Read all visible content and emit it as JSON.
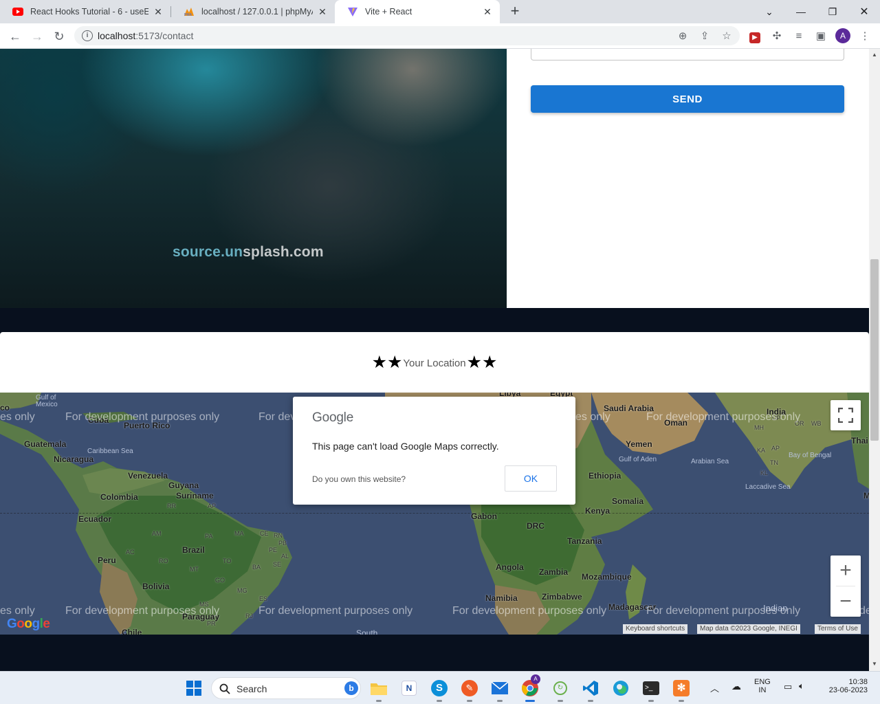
{
  "browser": {
    "tabs": [
      {
        "title": "React Hooks Tutorial - 6 - useEffe",
        "favicon": "youtube-icon",
        "active": false
      },
      {
        "title": "localhost / 127.0.0.1 | phpMyAdm",
        "favicon": "phpmyadmin-icon",
        "active": false
      },
      {
        "title": "Vite + React",
        "favicon": "vite-icon",
        "active": true
      }
    ],
    "address": {
      "host": "localhost",
      "path": ":5173/contact"
    },
    "profile_initial": "A"
  },
  "page": {
    "hero_watermark": {
      "part1": "source.un",
      "part2": "splash.com"
    },
    "send_label": "SEND",
    "location": {
      "star": "★",
      "title": "Your Location"
    }
  },
  "map": {
    "dev_text": "For development purposes only",
    "dev_text_cut": "es only",
    "dev_text_start": "For dev",
    "dev_text_tail": "de",
    "labels": {
      "puerto_rico": "Puerto Rico",
      "guatemala": "Guatemala",
      "nicaragua": "Nicaragua",
      "venezuela": "Venezuela",
      "guyana": "Guyana",
      "suriname": "Suriname",
      "colombia": "Colombia",
      "ecuador": "Ecuador",
      "peru": "Peru",
      "brazil": "Brazil",
      "bolivia": "Bolivia",
      "paraguay": "Paraguay",
      "chile": "Chile",
      "saudi_arabia": "Saudi Arabia",
      "oman": "Oman",
      "yemen": "Yemen",
      "ethiopia": "Ethiopia",
      "somalia": "Somalia",
      "kenya": "Kenya",
      "gabon": "Gabon",
      "drc": "DRC",
      "tanzania": "Tanzania",
      "angola": "Angola",
      "zambia": "Zambia",
      "mozambique": "Mozambique",
      "namibia": "Namibia",
      "zimbabwe": "Zimbabwe",
      "madagascar": "Madagascar",
      "india": "India",
      "yemen_gulf": "Gulf of Aden",
      "libya": "Libya",
      "egypt": "Egypt",
      "cuba": "Cuba",
      "mexico_gulf": "Gulf of\nMexico",
      "caribbean": "Caribbean Sea",
      "arabian_sea": "Arabian Sea",
      "bengal": "Bay of Bengal",
      "laccadive": "Laccadive Sea",
      "indian_ocean": "Indian",
      "south": "South",
      "thai": "Thai",
      "co": "co",
      "m": "M"
    },
    "states": [
      "RR",
      "AP",
      "AM",
      "PA",
      "MA",
      "CE",
      "RN",
      "PB",
      "PE",
      "AL",
      "SE",
      "AC",
      "RO",
      "TO",
      "BA",
      "MT",
      "GO",
      "MG",
      "ES",
      "MS",
      "RJ",
      "PR",
      "MH",
      "KA",
      "AP",
      "TN",
      "KL",
      "OR",
      "WB",
      "UP"
    ],
    "attribution": {
      "shortcuts": "Keyboard shortcuts",
      "data": "Map data ©2023 Google, INEGI",
      "terms": "Terms of Use"
    },
    "google_logo": "Google",
    "dialog": {
      "brand": "Google",
      "message": "This page can't load Google Maps correctly.",
      "question": "Do you own this website?",
      "ok": "OK"
    }
  },
  "taskbar": {
    "search_label": "Search",
    "lang_top": "ENG",
    "lang_bottom": "IN",
    "time": "10:38",
    "date": "23-06-2023"
  }
}
